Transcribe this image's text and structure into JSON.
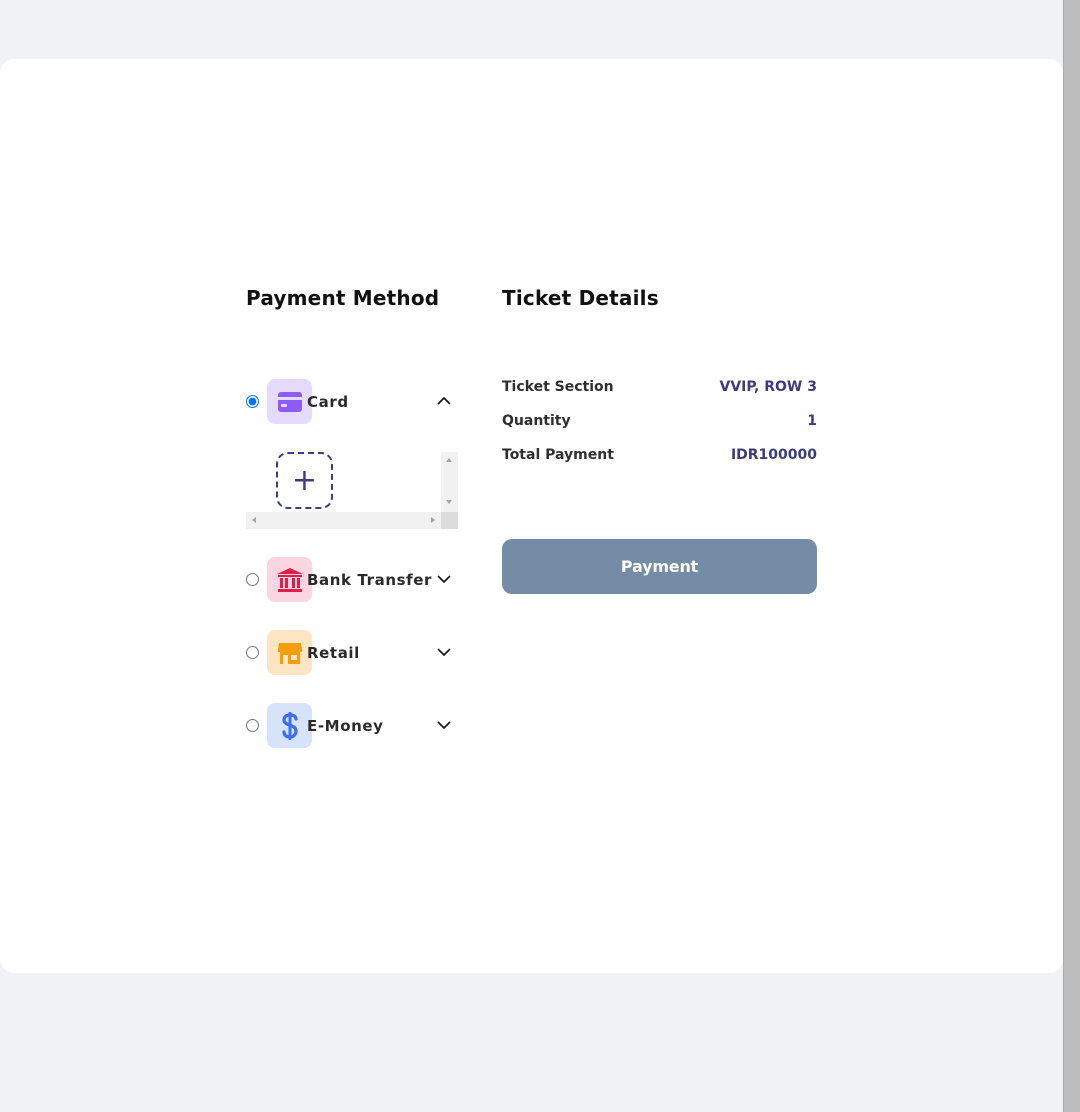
{
  "payment_method": {
    "title": "Payment Method",
    "methods": [
      {
        "label": "Card",
        "icon": "credit-card-icon",
        "icon_color": "#8b5cf6",
        "icon_bg": "#e6dbfd",
        "selected": true,
        "expanded": true
      },
      {
        "label": "Bank Transfer",
        "icon": "bank-icon",
        "icon_color": "#e11d48",
        "icon_bg": "#fbd5e0",
        "selected": false,
        "expanded": false
      },
      {
        "label": "Retail",
        "icon": "store-icon",
        "icon_color": "#f59e0b",
        "icon_bg": "#fde4c3",
        "selected": false,
        "expanded": false
      },
      {
        "label": "E-Money",
        "icon": "dollar-icon",
        "icon_color": "#3b6df0",
        "icon_bg": "#d7e2fb",
        "selected": false,
        "expanded": false
      }
    ],
    "add_card_symbol": "+"
  },
  "ticket_details": {
    "title": "Ticket Details",
    "rows": [
      {
        "label": "Ticket Section",
        "value": "VVIP, ROW 3"
      },
      {
        "label": "Quantity",
        "value": "1"
      },
      {
        "label": "Total Payment",
        "value": "IDR100000"
      }
    ]
  },
  "payment_button": {
    "label": "Payment",
    "color": "#748ca6"
  },
  "colors": {
    "accent": "#3d3a7e",
    "page_bg": "#f1f2f6",
    "panel_bg": "#ffffff"
  }
}
